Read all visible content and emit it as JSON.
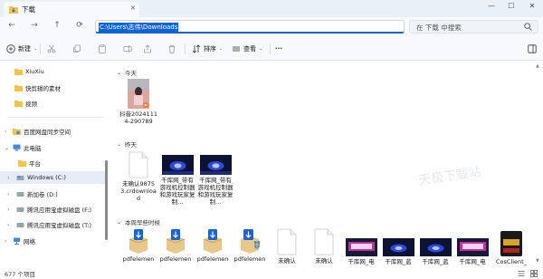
{
  "window": {
    "tab_title": "下载",
    "minimize": "—",
    "maximize": "☐",
    "close": "✕"
  },
  "nav": {
    "address": "C:\\Users\\志伟\\Downloads",
    "search_placeholder": "在 下载 中搜索"
  },
  "toolbar": {
    "new_label": "新建",
    "sort_label": "排序",
    "view_label": "查看",
    "more_label": "···"
  },
  "sidebar": {
    "items": [
      {
        "label": "XiuXiu"
      },
      {
        "label": "快剪辑的素材"
      },
      {
        "label": "视频"
      },
      {
        "label": "百度网盘同步空间"
      },
      {
        "label": "此电脑"
      },
      {
        "label": "平台"
      },
      {
        "label": "Windows (C:)"
      },
      {
        "label": "新加卷 (D:)"
      },
      {
        "label": "腾讯应用宝虚拟磁盘 (F:)"
      },
      {
        "label": "腾讯应用宝虚拟磁盘 (T:)"
      },
      {
        "label": "网络"
      }
    ]
  },
  "groups": {
    "today": "今天",
    "yesterday": "昨天",
    "earlier_this_week": "本周早些时候"
  },
  "files": {
    "today": [
      {
        "name": "抖音20241114-290789"
      }
    ],
    "yesterday": [
      {
        "name": "未确认98753.crdownload"
      },
      {
        "name": "千库网_带有游戏机控制器和游戏玩家复制..."
      },
      {
        "name": "千库网_带有游戏机控制器和游戏玩家复制..."
      }
    ],
    "week": [
      {
        "name": "pdfelemen"
      },
      {
        "name": "pdfelemen"
      },
      {
        "name": "pdfelemen"
      },
      {
        "name": "pdfelemen"
      },
      {
        "name": "未确认"
      },
      {
        "name": "未确认"
      },
      {
        "name": "千库网_电"
      },
      {
        "name": "千库网_蓝"
      },
      {
        "name": "千库网_蓝"
      },
      {
        "name": "千库网_电"
      },
      {
        "name": "CosClient_"
      }
    ]
  },
  "watermark": "天极下载站",
  "status": {
    "item_count": "677 个项目"
  },
  "colors": {
    "accent": "#0a64d8",
    "folder": "#f2c14e",
    "selected": "#e5ecf5"
  }
}
